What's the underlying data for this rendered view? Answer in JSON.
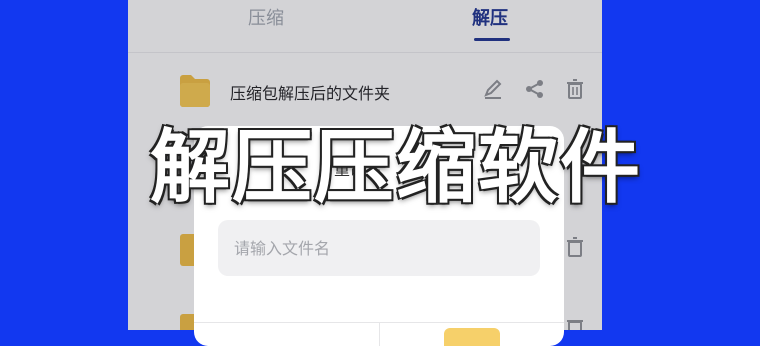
{
  "tabs": [
    {
      "label": "压缩",
      "active": false
    },
    {
      "label": "解压",
      "active": true
    }
  ],
  "folder_item": {
    "name": "压缩包解压后的文件夹"
  },
  "dialog": {
    "title_fragment": "重命名",
    "input_placeholder": "请输入文件名"
  },
  "overlay": {
    "title": "解压压缩软件"
  },
  "colors": {
    "background": "#1238f0",
    "accent": "#1a2f8c",
    "folder": "#e8b640",
    "confirm": "#f6d06a"
  },
  "icons": [
    "folder-icon",
    "edit-icon",
    "share-icon",
    "trash-icon"
  ]
}
